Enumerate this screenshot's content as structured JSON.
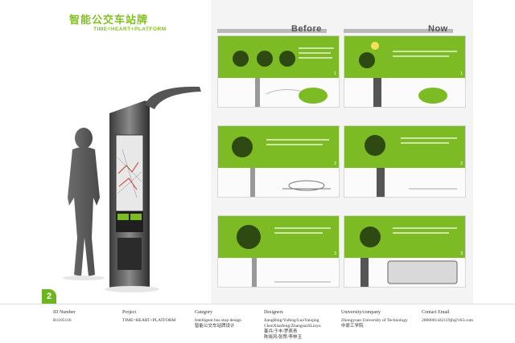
{
  "left_page": {
    "title_zh": "智能公交车站牌",
    "subtitle_en": "TIME=HEART+PLATFORM",
    "page_number": "2"
  },
  "right_page": {
    "before_label": "Before",
    "now_label": "Now",
    "panel_numbers": [
      "1",
      "1",
      "2",
      "2",
      "3",
      "3"
    ]
  },
  "info": {
    "id_number": {
      "label": "ID Number",
      "value": "B1105116"
    },
    "project": {
      "label": "Project",
      "value": "TIME=HEART+PLATFORM"
    },
    "category": {
      "label": "Category",
      "value_en": "Intelligent bus stop design",
      "value_zh": "智能公交车站牌设计"
    },
    "designers": {
      "label": "Designers",
      "line1": "JiangBing/Yufeng/LuoYanqing",
      "line2": "ChenXiaofeng/ZhangsaiJiLinyu",
      "line3": "姜兵/于丰/罗燕青",
      "line4": "陈晓风/张赞/李林玉"
    },
    "university": {
      "label": "University/company",
      "value_en": "Zhongyuan University of Technology",
      "value_zh": "中原工学院"
    },
    "contact": {
      "label": "Contact Email",
      "value": "2008001442119jb@163.com"
    }
  },
  "colors": {
    "accent_green": "#7dbb25",
    "title_green": "#7fc31c"
  }
}
